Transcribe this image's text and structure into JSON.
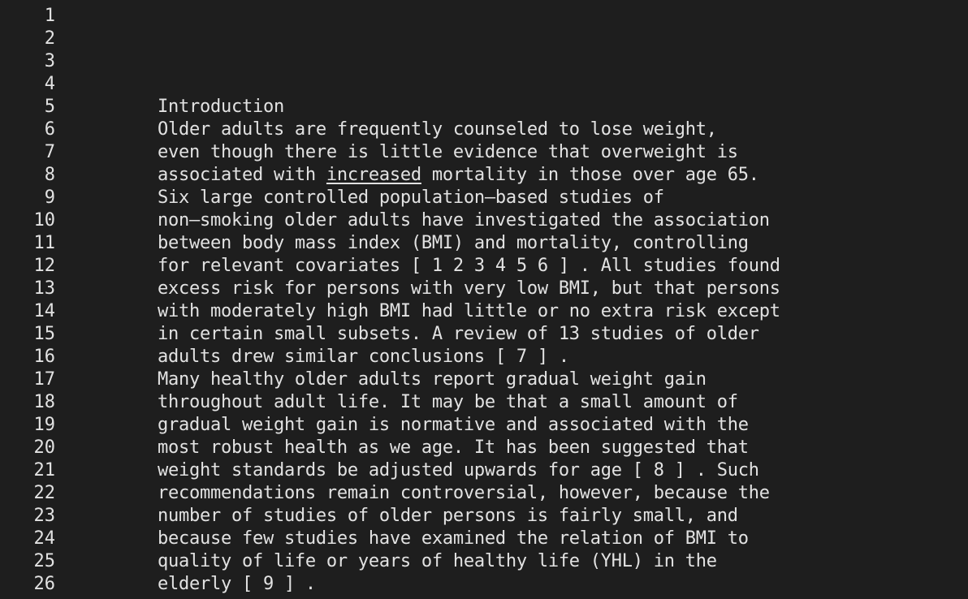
{
  "editor": {
    "lines": [
      {
        "n": "1",
        "pre": "",
        "u": "",
        "post": ""
      },
      {
        "n": "2",
        "pre": "",
        "u": "",
        "post": ""
      },
      {
        "n": "3",
        "pre": "",
        "u": "",
        "post": ""
      },
      {
        "n": "4",
        "pre": "",
        "u": "",
        "post": ""
      },
      {
        "n": "5",
        "pre": "Introduction",
        "u": "",
        "post": ""
      },
      {
        "n": "6",
        "pre": "Older adults are frequently counseled to lose weight,",
        "u": "",
        "post": ""
      },
      {
        "n": "7",
        "pre": "even though there is little evidence that overweight is",
        "u": "",
        "post": ""
      },
      {
        "n": "8",
        "pre": "associated with ",
        "u": "increased",
        "post": " mortality in those over age 65."
      },
      {
        "n": "9",
        "pre": "Six large controlled population–based studies of",
        "u": "",
        "post": ""
      },
      {
        "n": "10",
        "pre": "non–smoking older adults have investigated the association",
        "u": "",
        "post": ""
      },
      {
        "n": "11",
        "pre": "between body mass index (BMI) and mortality, controlling",
        "u": "",
        "post": ""
      },
      {
        "n": "12",
        "pre": "for relevant covariates [ 1 2 3 4 5 6 ] . All studies found",
        "u": "",
        "post": ""
      },
      {
        "n": "13",
        "pre": "excess risk for persons with very low BMI, but that persons",
        "u": "",
        "post": ""
      },
      {
        "n": "14",
        "pre": "with moderately high BMI had little or no extra risk except",
        "u": "",
        "post": ""
      },
      {
        "n": "15",
        "pre": "in certain small subsets. A review of 13 studies of older",
        "u": "",
        "post": ""
      },
      {
        "n": "16",
        "pre": "adults drew similar conclusions [ 7 ] .",
        "u": "",
        "post": ""
      },
      {
        "n": "17",
        "pre": "Many healthy older adults report gradual weight gain",
        "u": "",
        "post": ""
      },
      {
        "n": "18",
        "pre": "throughout adult life. It may be that a small amount of",
        "u": "",
        "post": ""
      },
      {
        "n": "19",
        "pre": "gradual weight gain is normative and associated with the",
        "u": "",
        "post": ""
      },
      {
        "n": "20",
        "pre": "most robust health as we age. It has been suggested that",
        "u": "",
        "post": ""
      },
      {
        "n": "21",
        "pre": "weight standards be adjusted upwards for age [ 8 ] . Such",
        "u": "",
        "post": ""
      },
      {
        "n": "22",
        "pre": "recommendations remain controversial, however, because the",
        "u": "",
        "post": ""
      },
      {
        "n": "23",
        "pre": "number of studies of older persons is fairly small, and",
        "u": "",
        "post": ""
      },
      {
        "n": "24",
        "pre": "because few studies have examined the relation of BMI to",
        "u": "",
        "post": ""
      },
      {
        "n": "25",
        "pre": "quality of life or years of healthy life (YHL) in the",
        "u": "",
        "post": ""
      },
      {
        "n": "26",
        "pre": "elderly [ 9 ] .",
        "u": "",
        "post": ""
      }
    ]
  }
}
